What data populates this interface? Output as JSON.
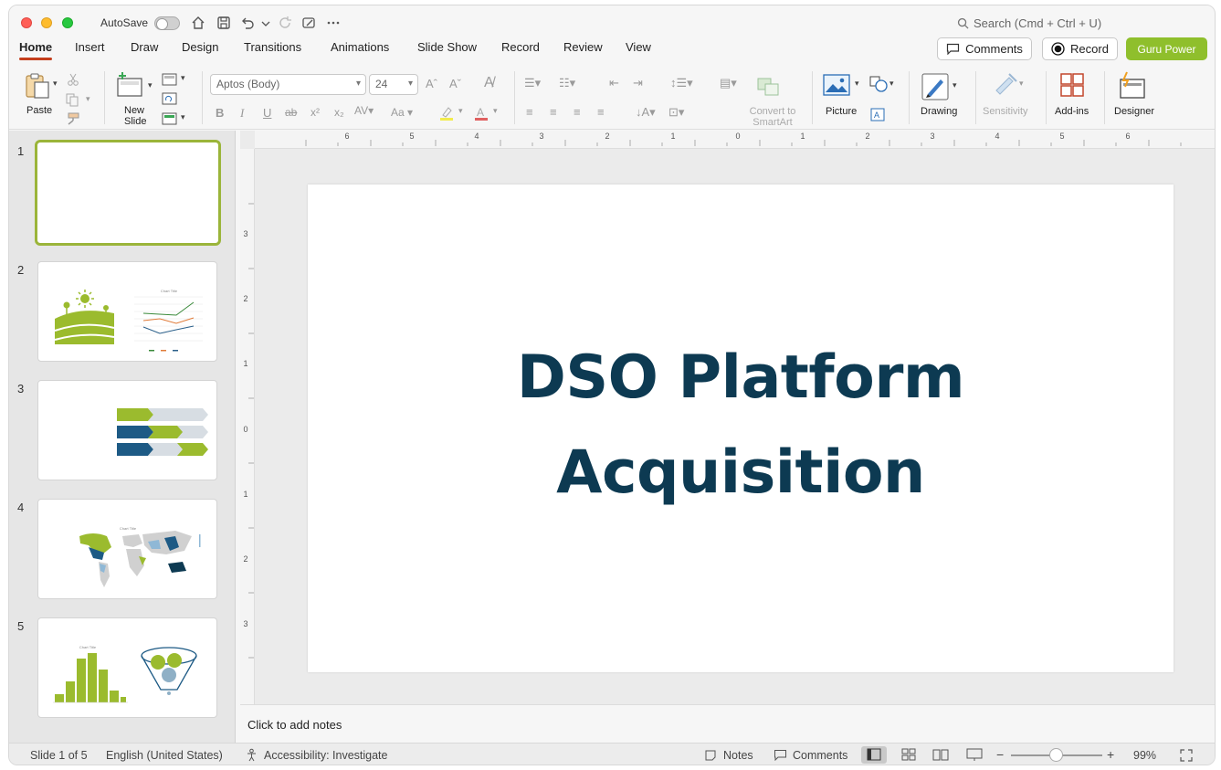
{
  "titlebar": {
    "autosave_label": "AutoSave",
    "search_placeholder": "Search (Cmd + Ctrl + U)"
  },
  "tabs": [
    "Home",
    "Insert",
    "Draw",
    "Design",
    "Transitions",
    "Animations",
    "Slide Show",
    "Record",
    "Review",
    "View"
  ],
  "top_buttons": {
    "comments": "Comments",
    "record": "Record",
    "guru": "Guru Power"
  },
  "ribbon": {
    "paste": "Paste",
    "new_slide_1": "New",
    "new_slide_2": "Slide",
    "font_name": "Aptos (Body)",
    "font_size": "24",
    "convert_1": "Convert to",
    "convert_2": "SmartArt",
    "picture": "Picture",
    "drawing": "Drawing",
    "sensitivity": "Sensitivity",
    "addins": "Add-ins",
    "designer": "Designer"
  },
  "slides": [
    {
      "num": "1"
    },
    {
      "num": "2"
    },
    {
      "num": "3"
    },
    {
      "num": "4"
    },
    {
      "num": "5"
    }
  ],
  "thumb_texts": {
    "chart_title": "Chart Title"
  },
  "ruler": {
    "h_labels": [
      "6",
      "5",
      "4",
      "3",
      "2",
      "1",
      "0",
      "1",
      "2",
      "3",
      "4",
      "5",
      "6"
    ],
    "v_labels": [
      "3",
      "2",
      "1",
      "0",
      "1",
      "2",
      "3"
    ]
  },
  "slide": {
    "title_line1": "DSO Platform",
    "title_line2": "Acquisition"
  },
  "notes_placeholder": "Click to add notes",
  "status": {
    "slide_info": "Slide 1 of 5",
    "language": "English (United States)",
    "accessibility": "Accessibility: Investigate",
    "notes": "Notes",
    "comments": "Comments",
    "zoom": "99%"
  },
  "colors": {
    "accent_green": "#8fbf2c",
    "title_navy": "#0d3a52",
    "tab_underline": "#c43e1c"
  }
}
